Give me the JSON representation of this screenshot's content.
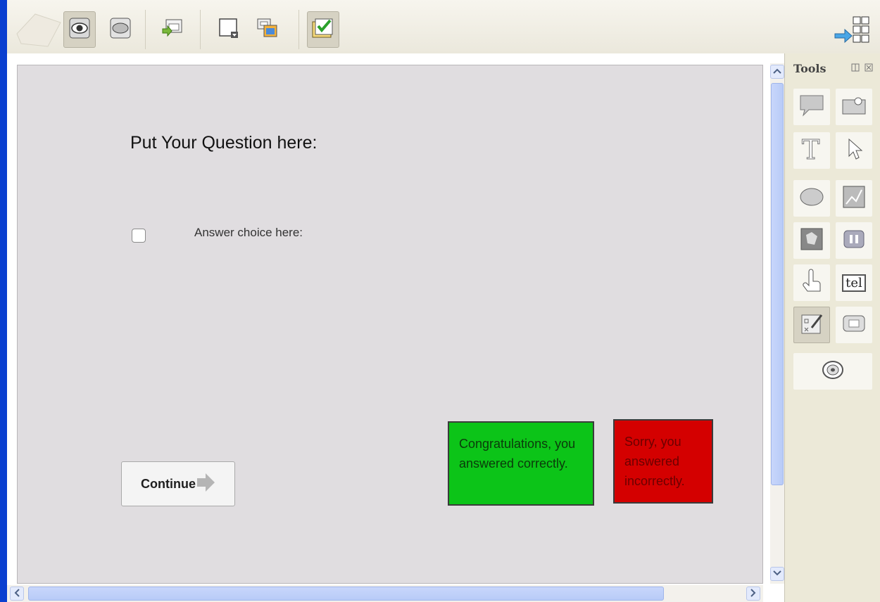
{
  "toolbar": {
    "buttons": [
      {
        "icon": "eye-icon",
        "active": true
      },
      {
        "icon": "oval-button-icon",
        "active": false
      },
      {
        "icon": "slide-import-icon",
        "active": false
      },
      {
        "icon": "slide-layout-icon",
        "active": false
      },
      {
        "icon": "image-slide-icon",
        "active": false
      },
      {
        "icon": "quiz-checkbox-icon",
        "active": true
      }
    ],
    "right_icon": "switch-layout-icon"
  },
  "slide": {
    "question": "Put Your Question here:",
    "answer_choice": "Answer choice here:",
    "continue_label": "Continue",
    "correct_message": "Congratulations, you answered correctly.",
    "incorrect_message": "Sorry, you answered incorrectly."
  },
  "tools": {
    "title": "Tools",
    "items": [
      "speech-bubble-icon",
      "highlight-box-icon",
      "text-caption-icon",
      "pointer-icon",
      "shape-icon",
      "image-icon",
      "animation-icon",
      "media-icon",
      "click-box-icon",
      "text-entry-box-icon",
      "question-slide-icon",
      "button-icon",
      "rollover-icon"
    ],
    "text_entry_label": "tel"
  },
  "colors": {
    "correct": "#0cc418",
    "incorrect": "#d40000",
    "stage": "#e0dde0",
    "accent": "#0a3fd0"
  }
}
